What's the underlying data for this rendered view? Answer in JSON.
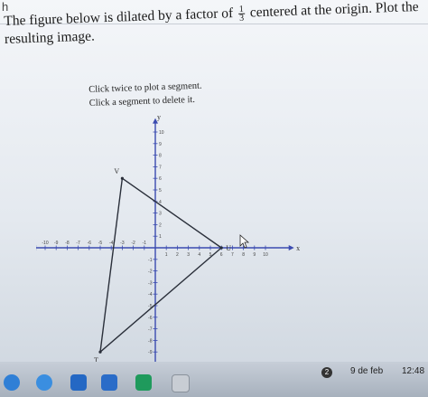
{
  "corner_text": "h",
  "question": {
    "before": "The figure below is dilated by a factor of",
    "factor_num": "1",
    "factor_den": "3",
    "after": "centered at the origin. Plot the resulting image."
  },
  "instructions": {
    "line1": "Click twice to plot a segment.",
    "line2": "Click a segment to delete it."
  },
  "graph": {
    "axis_x_label": "x",
    "axis_y_label": "y",
    "x_ticks": [
      "-10",
      "-9",
      "-8",
      "-7",
      "-6",
      "-5",
      "-4",
      "-3",
      "-2",
      "-1",
      "1",
      "2",
      "3",
      "4",
      "5",
      "6",
      "7",
      "8",
      "9",
      "10"
    ],
    "y_ticks": [
      "10",
      "9",
      "8",
      "7",
      "6",
      "5",
      "4",
      "3",
      "2",
      "1",
      "-1",
      "-2",
      "-3",
      "-4",
      "-5",
      "-6",
      "-7",
      "-8",
      "-9",
      "-10"
    ],
    "points": [
      {
        "label": "V",
        "x": -3,
        "y": 6
      },
      {
        "label": "U",
        "x": 6,
        "y": 0
      },
      {
        "label": "T",
        "x": -5,
        "y": -9
      }
    ],
    "line_color": "#2a2f3a"
  },
  "taskbar": {
    "badge": "2",
    "date": "9 de feb",
    "time": "12:48"
  }
}
